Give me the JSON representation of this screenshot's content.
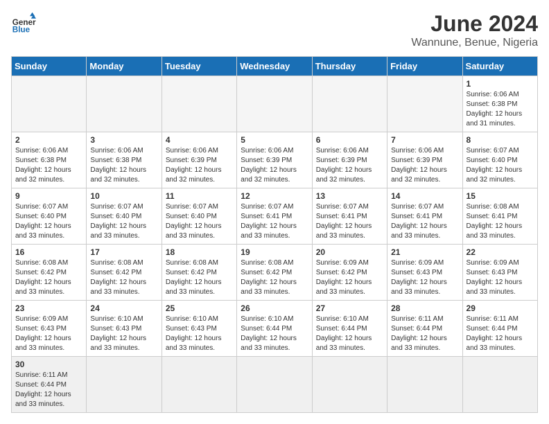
{
  "logo": {
    "general": "General",
    "blue": "Blue"
  },
  "title": "June 2024",
  "subtitle": "Wannune, Benue, Nigeria",
  "weekdays": [
    "Sunday",
    "Monday",
    "Tuesday",
    "Wednesday",
    "Thursday",
    "Friday",
    "Saturday"
  ],
  "weeks": [
    [
      {
        "day": "",
        "info": ""
      },
      {
        "day": "",
        "info": ""
      },
      {
        "day": "",
        "info": ""
      },
      {
        "day": "",
        "info": ""
      },
      {
        "day": "",
        "info": ""
      },
      {
        "day": "",
        "info": ""
      },
      {
        "day": "1",
        "info": "Sunrise: 6:06 AM\nSunset: 6:38 PM\nDaylight: 12 hours and 31 minutes."
      }
    ],
    [
      {
        "day": "2",
        "info": "Sunrise: 6:06 AM\nSunset: 6:38 PM\nDaylight: 12 hours and 32 minutes."
      },
      {
        "day": "3",
        "info": "Sunrise: 6:06 AM\nSunset: 6:38 PM\nDaylight: 12 hours and 32 minutes."
      },
      {
        "day": "4",
        "info": "Sunrise: 6:06 AM\nSunset: 6:39 PM\nDaylight: 12 hours and 32 minutes."
      },
      {
        "day": "5",
        "info": "Sunrise: 6:06 AM\nSunset: 6:39 PM\nDaylight: 12 hours and 32 minutes."
      },
      {
        "day": "6",
        "info": "Sunrise: 6:06 AM\nSunset: 6:39 PM\nDaylight: 12 hours and 32 minutes."
      },
      {
        "day": "7",
        "info": "Sunrise: 6:06 AM\nSunset: 6:39 PM\nDaylight: 12 hours and 32 minutes."
      },
      {
        "day": "8",
        "info": "Sunrise: 6:07 AM\nSunset: 6:40 PM\nDaylight: 12 hours and 32 minutes."
      }
    ],
    [
      {
        "day": "9",
        "info": "Sunrise: 6:07 AM\nSunset: 6:40 PM\nDaylight: 12 hours and 33 minutes."
      },
      {
        "day": "10",
        "info": "Sunrise: 6:07 AM\nSunset: 6:40 PM\nDaylight: 12 hours and 33 minutes."
      },
      {
        "day": "11",
        "info": "Sunrise: 6:07 AM\nSunset: 6:40 PM\nDaylight: 12 hours and 33 minutes."
      },
      {
        "day": "12",
        "info": "Sunrise: 6:07 AM\nSunset: 6:41 PM\nDaylight: 12 hours and 33 minutes."
      },
      {
        "day": "13",
        "info": "Sunrise: 6:07 AM\nSunset: 6:41 PM\nDaylight: 12 hours and 33 minutes."
      },
      {
        "day": "14",
        "info": "Sunrise: 6:07 AM\nSunset: 6:41 PM\nDaylight: 12 hours and 33 minutes."
      },
      {
        "day": "15",
        "info": "Sunrise: 6:08 AM\nSunset: 6:41 PM\nDaylight: 12 hours and 33 minutes."
      }
    ],
    [
      {
        "day": "16",
        "info": "Sunrise: 6:08 AM\nSunset: 6:42 PM\nDaylight: 12 hours and 33 minutes."
      },
      {
        "day": "17",
        "info": "Sunrise: 6:08 AM\nSunset: 6:42 PM\nDaylight: 12 hours and 33 minutes."
      },
      {
        "day": "18",
        "info": "Sunrise: 6:08 AM\nSunset: 6:42 PM\nDaylight: 12 hours and 33 minutes."
      },
      {
        "day": "19",
        "info": "Sunrise: 6:08 AM\nSunset: 6:42 PM\nDaylight: 12 hours and 33 minutes."
      },
      {
        "day": "20",
        "info": "Sunrise: 6:09 AM\nSunset: 6:42 PM\nDaylight: 12 hours and 33 minutes."
      },
      {
        "day": "21",
        "info": "Sunrise: 6:09 AM\nSunset: 6:43 PM\nDaylight: 12 hours and 33 minutes."
      },
      {
        "day": "22",
        "info": "Sunrise: 6:09 AM\nSunset: 6:43 PM\nDaylight: 12 hours and 33 minutes."
      }
    ],
    [
      {
        "day": "23",
        "info": "Sunrise: 6:09 AM\nSunset: 6:43 PM\nDaylight: 12 hours and 33 minutes."
      },
      {
        "day": "24",
        "info": "Sunrise: 6:10 AM\nSunset: 6:43 PM\nDaylight: 12 hours and 33 minutes."
      },
      {
        "day": "25",
        "info": "Sunrise: 6:10 AM\nSunset: 6:43 PM\nDaylight: 12 hours and 33 minutes."
      },
      {
        "day": "26",
        "info": "Sunrise: 6:10 AM\nSunset: 6:44 PM\nDaylight: 12 hours and 33 minutes."
      },
      {
        "day": "27",
        "info": "Sunrise: 6:10 AM\nSunset: 6:44 PM\nDaylight: 12 hours and 33 minutes."
      },
      {
        "day": "28",
        "info": "Sunrise: 6:11 AM\nSunset: 6:44 PM\nDaylight: 12 hours and 33 minutes."
      },
      {
        "day": "29",
        "info": "Sunrise: 6:11 AM\nSunset: 6:44 PM\nDaylight: 12 hours and 33 minutes."
      }
    ],
    [
      {
        "day": "30",
        "info": "Sunrise: 6:11 AM\nSunset: 6:44 PM\nDaylight: 12 hours and 33 minutes."
      },
      {
        "day": "",
        "info": ""
      },
      {
        "day": "",
        "info": ""
      },
      {
        "day": "",
        "info": ""
      },
      {
        "day": "",
        "info": ""
      },
      {
        "day": "",
        "info": ""
      },
      {
        "day": "",
        "info": ""
      }
    ]
  ],
  "accent_color": "#1a6fb5"
}
